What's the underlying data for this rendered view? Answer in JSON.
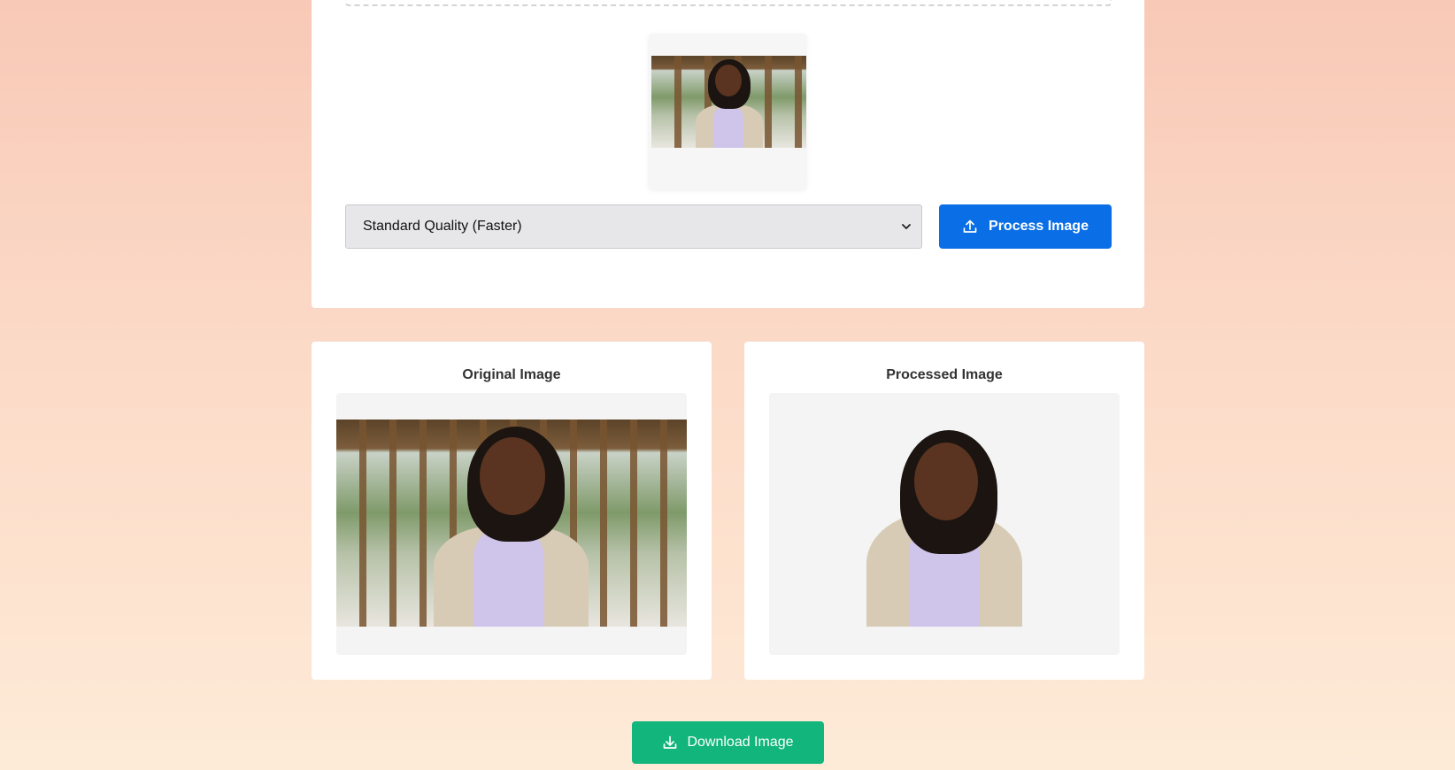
{
  "upload": {
    "quality_select": {
      "selected": "Standard Quality (Faster)"
    },
    "process_button": {
      "label": "Process Image",
      "icon": "upload-icon",
      "color": "#0a6ee6"
    },
    "preview_thumbnail": {
      "icon": "image-thumbnail"
    }
  },
  "results": {
    "original": {
      "title": "Original Image"
    },
    "processed": {
      "title": "Processed Image"
    }
  },
  "download_button": {
    "label": "Download Image",
    "icon": "download-icon",
    "color": "#12b57c"
  }
}
